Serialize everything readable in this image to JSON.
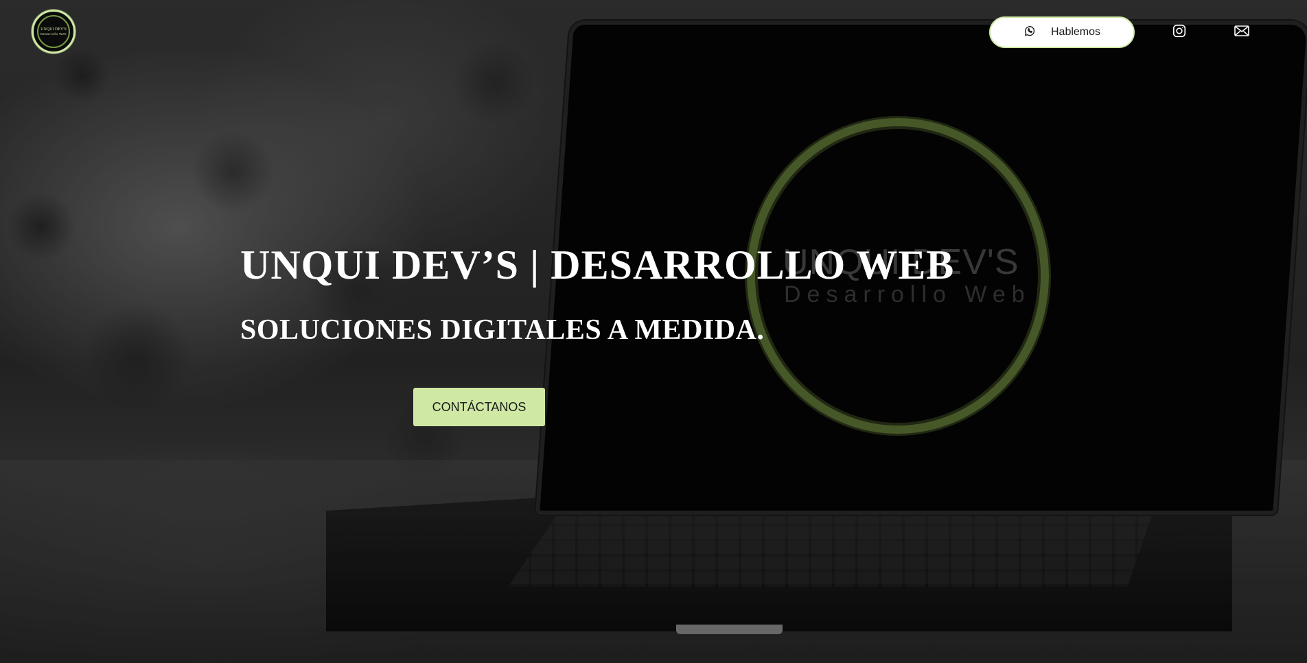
{
  "header": {
    "logo": {
      "text_line1": "UNQUI DEV'S",
      "text_line2": "Desarrollo Web"
    },
    "contact_button": {
      "label": "Hablemos",
      "icon": "whatsapp-icon"
    },
    "social_icons": [
      "instagram-icon",
      "mail-icon"
    ]
  },
  "hero": {
    "title": "UNQUI DEV’S | DESARROLLO WEB",
    "subtitle": "SOLUCIONES DIGITALES A MEDIDA.",
    "cta_label": "CONTÁCTANOS"
  },
  "background_screen": {
    "title": "UNQUI DEV'S",
    "subtitle": "Desarrollo Web"
  },
  "colors": {
    "accent": "#cfe8a3",
    "ring": "#6f8a3f",
    "text": "#ffffff"
  }
}
